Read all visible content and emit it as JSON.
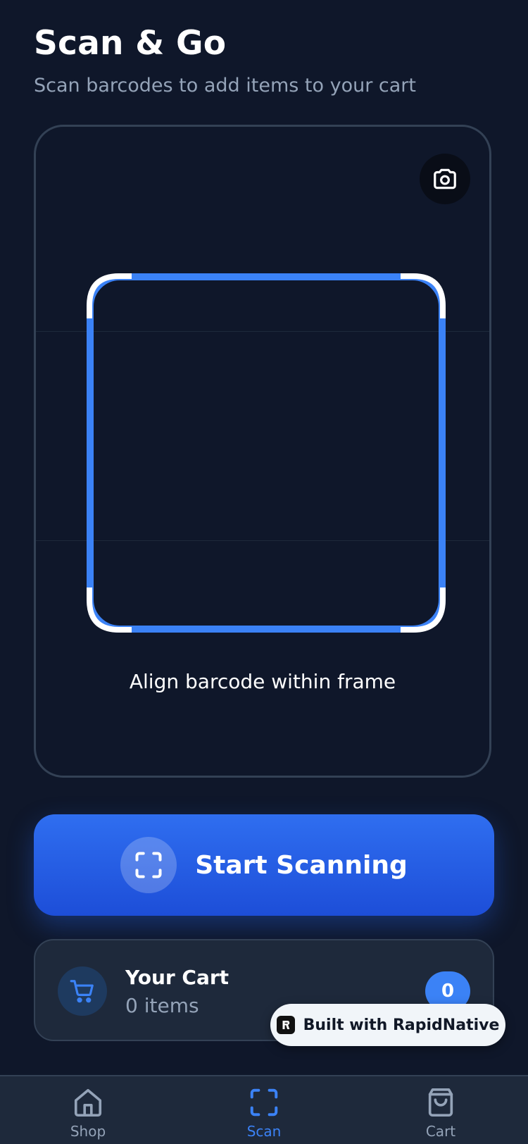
{
  "header": {
    "title": "Scan & Go",
    "subtitle": "Scan barcodes to add items to your cart"
  },
  "scanner": {
    "instruction": "Align barcode within frame",
    "camera_icon": "camera-icon",
    "frame_color": "#3b82f6",
    "corner_color": "#ffffff"
  },
  "scan_button": {
    "label": "Start Scanning",
    "icon": "scan-icon"
  },
  "cart": {
    "title": "Your Cart",
    "subtitle": "0 items",
    "badge": "0",
    "icon": "cart-icon"
  },
  "built_with": {
    "label": "Built with RapidNative"
  },
  "tabs": [
    {
      "label": "Shop",
      "icon": "home-icon",
      "active": false
    },
    {
      "label": "Scan",
      "icon": "scan-icon",
      "active": true
    },
    {
      "label": "Cart",
      "icon": "shopping-bag-icon",
      "active": false
    }
  ],
  "colors": {
    "background": "#0f172a",
    "accent": "#3b82f6",
    "muted": "#94a3b8",
    "inactive_tab": "#94a3b8"
  }
}
